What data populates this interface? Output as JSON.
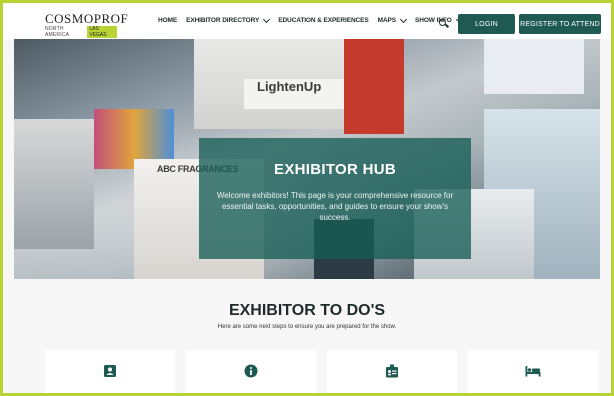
{
  "header": {
    "logo": {
      "main": "COSMOPROF",
      "sub": "NORTH AMERICA",
      "city": "LAS VEGAS"
    },
    "nav": [
      {
        "label": "HOME",
        "has_dropdown": false
      },
      {
        "label": "EXHIBITOR DIRECTORY",
        "has_dropdown": true
      },
      {
        "label": "EDUCATION & EXPERIENCES",
        "has_dropdown": false
      },
      {
        "label": "MAPS",
        "has_dropdown": true
      },
      {
        "label": "SHOW INFO",
        "has_dropdown": true
      }
    ],
    "login_label": "LOGIN",
    "register_label": "REGISTER TO ATTEND"
  },
  "hero": {
    "title": "EXHIBITOR HUB",
    "text": "Welcome exhibitors! This page is your comprehensive resource for essential tasks, opportunities, and guides to ensure your show's success.",
    "photo_signs": {
      "lighten": "LightenUp",
      "abc": "ABC FRAGRANCES"
    }
  },
  "section": {
    "title": "EXHIBITOR TO DO'S",
    "subtitle": "Here are some next steps to ensure you are prepared for the show."
  },
  "cards": [
    {
      "icon": "id-badge-icon"
    },
    {
      "icon": "info-icon"
    },
    {
      "icon": "id-card-clip-icon"
    },
    {
      "icon": "bed-icon"
    }
  ],
  "colors": {
    "accent": "#1f5a52",
    "brand_lime": "#b7d334",
    "overlay": "#175e56"
  }
}
